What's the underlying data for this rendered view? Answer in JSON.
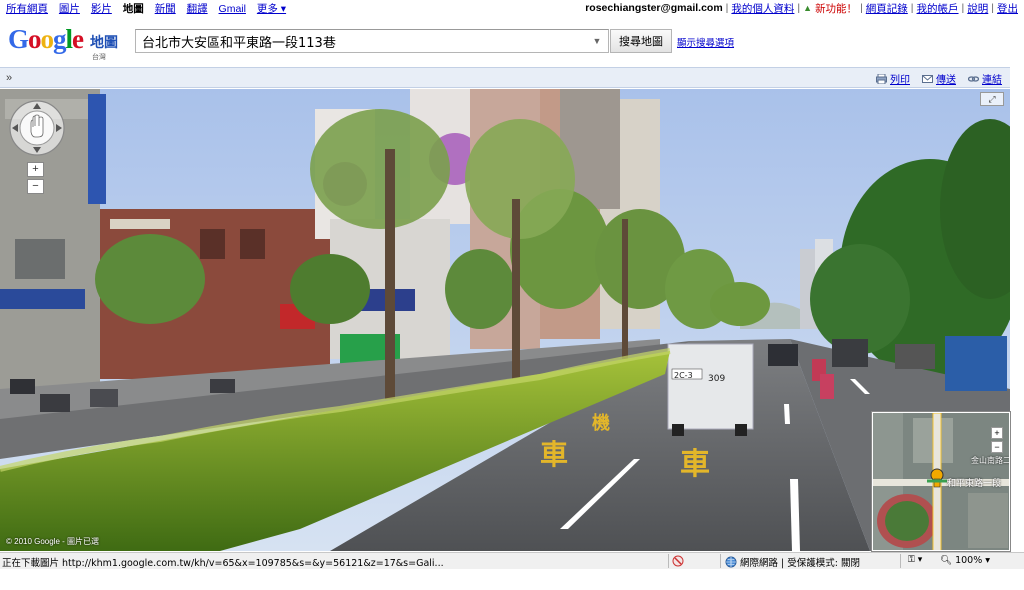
{
  "topbar": {
    "nav": [
      {
        "label": "所有網頁",
        "active": false
      },
      {
        "label": "圖片",
        "active": false
      },
      {
        "label": "影片",
        "active": false
      },
      {
        "label": "地圖",
        "active": true
      },
      {
        "label": "新聞",
        "active": false
      },
      {
        "label": "翻譯",
        "active": false
      },
      {
        "label": "Gmail",
        "active": false
      },
      {
        "label": "更多 ▾",
        "active": false
      }
    ],
    "email": "rosechiangster@gmail.com",
    "profile_link": "我的個人資料",
    "new_features": "新功能！",
    "history_link": "網頁記錄",
    "account_link": "我的帳戶",
    "help_link": "說明",
    "signout_link": "登出"
  },
  "header": {
    "logo_text": "Google",
    "logo_maps": "地圖",
    "logo_region": "台灣",
    "search_value": "台北市大安區和平東路一段113巷",
    "search_button": "搜尋地圖",
    "search_options": "顯示搜尋選項"
  },
  "toolbar": {
    "collapse": "»",
    "print": "列印",
    "send": "傳送",
    "link": "連結"
  },
  "streetview": {
    "copyright": "© 2010 Google - 圖片已選",
    "fullscreen": "⤢",
    "zoom_in": "+",
    "zoom_out": "−",
    "minimap": {
      "road_label": "和平東路一段",
      "road_label_2": "金山南路二段",
      "zoom_in": "+",
      "zoom_out": "−"
    }
  },
  "statusbar": {
    "text": "正在下載圖片 http://khm1.google.com.tw/kh/v=65&x=109785&s=&y=56121&z=17&s=Gali...",
    "zone": "網際網路 | 受保護模式: 關閉",
    "zoom": "100%"
  },
  "colors": {
    "google_blue": "#3369e8",
    "google_red": "#d50f25",
    "google_yellow": "#eeb211",
    "google_green": "#009925",
    "toolbar_bg": "#e8eef7",
    "link": "#0000cc"
  }
}
